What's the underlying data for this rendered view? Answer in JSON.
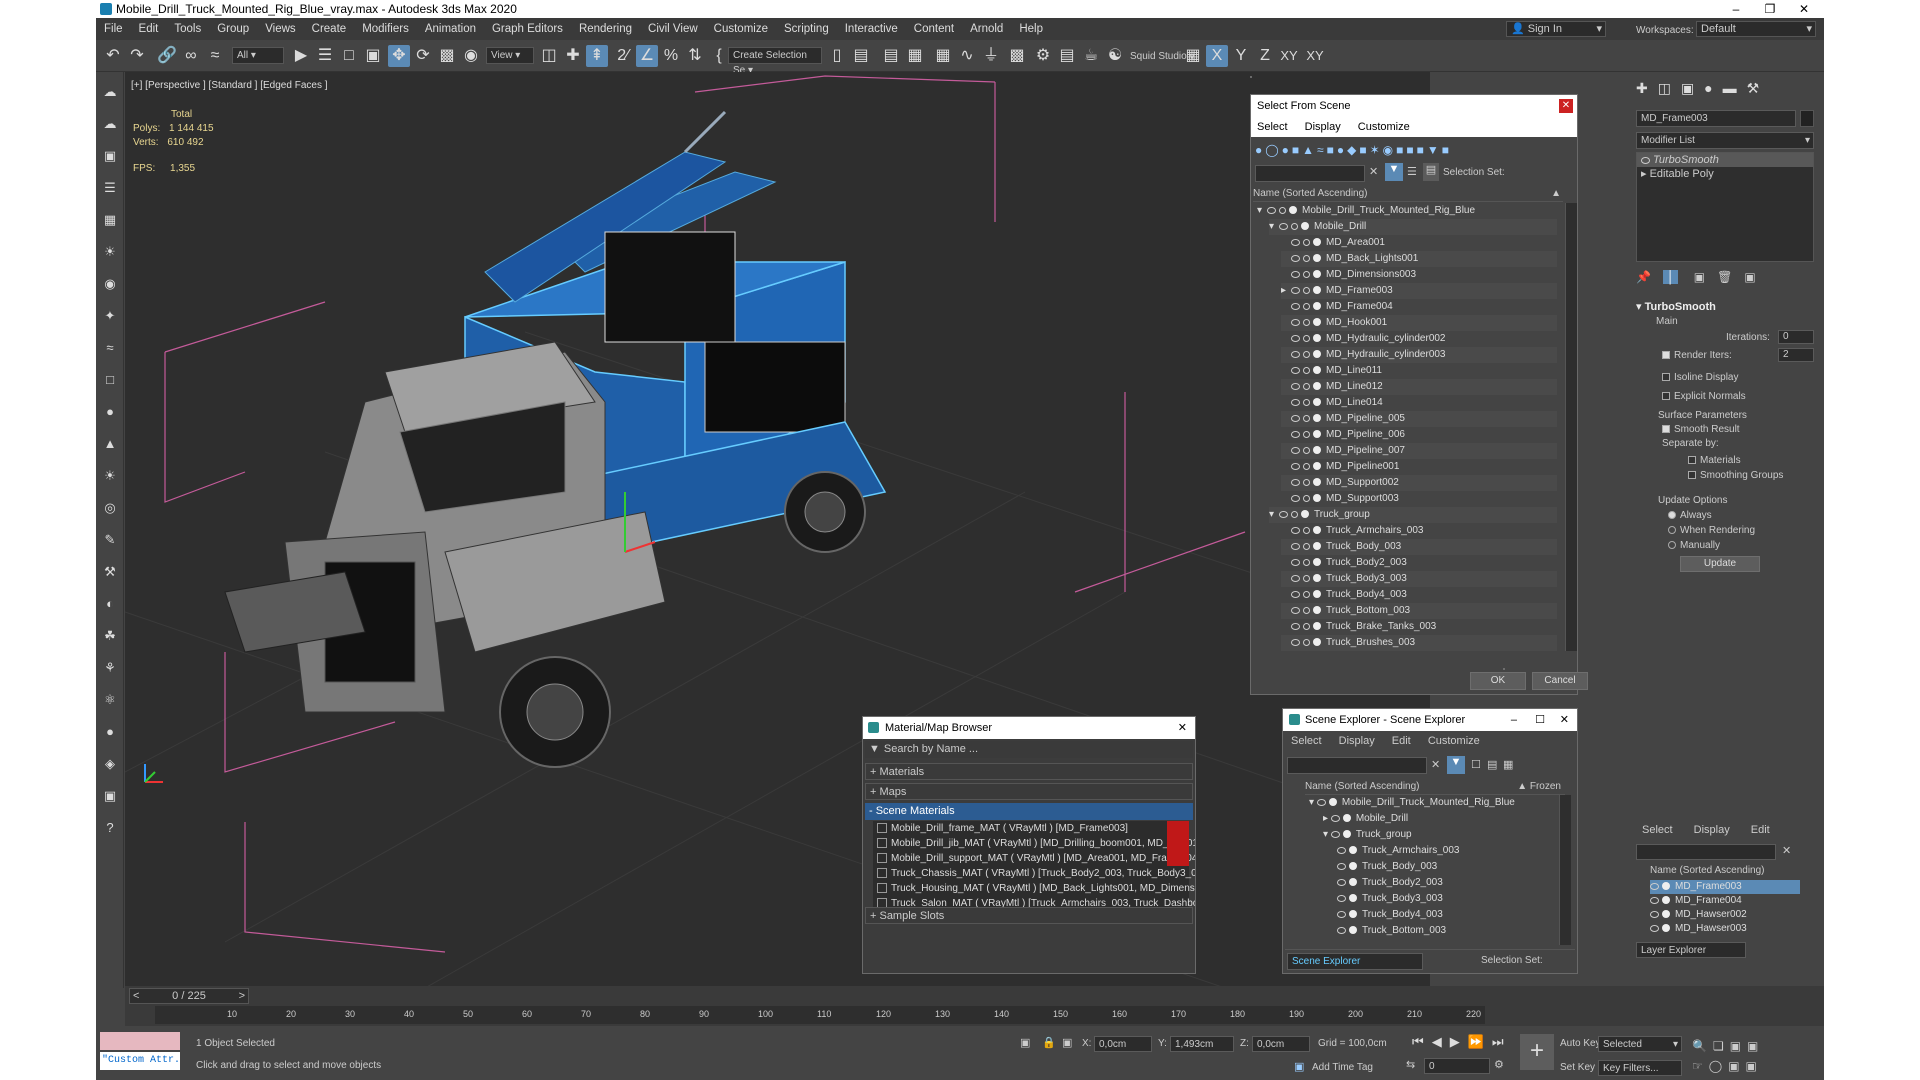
{
  "title": "Mobile_Drill_Truck_Mounted_Rig_Blue_vray.max - Autodesk 3ds Max 2020",
  "menu": [
    "File",
    "Edit",
    "Tools",
    "Group",
    "Views",
    "Create",
    "Modifiers",
    "Animation",
    "Graph Editors",
    "Rendering",
    "Civil View",
    "Customize",
    "Scripting",
    "Interactive",
    "Content",
    "Arnold",
    "Help"
  ],
  "signin": "Sign In",
  "workspaces_label": "Workspaces:",
  "workspace": "Default",
  "toolbar": {
    "filter": "All",
    "view": "View",
    "create_selection": "Create Selection Se",
    "squid": "Squid Studio v",
    "x": "X",
    "y": "Y",
    "z": "Z",
    "xy": "XY",
    "xy2": "XY"
  },
  "viewport": {
    "label": "[+] [Perspective ] [Standard ] [Edged Faces ]",
    "total": "Total",
    "polys_label": "Polys:",
    "polys": "1 144 415",
    "verts_label": "Verts:",
    "verts": "610 492",
    "fps_label": "FPS:",
    "fps": "1,355"
  },
  "select_scene": {
    "title": "Select From Scene",
    "menu": [
      "Select",
      "Display",
      "Customize"
    ],
    "selection_set": "Selection Set:",
    "col": "Name (Sorted Ascending)",
    "items": [
      {
        "n": "Mobile_Drill_Truck_Mounted_Rig_Blue",
        "l": 0,
        "g": true
      },
      {
        "n": "Mobile_Drill",
        "l": 1,
        "g": true
      },
      {
        "n": "MD_Area001",
        "l": 2
      },
      {
        "n": "MD_Back_Lights001",
        "l": 2
      },
      {
        "n": "MD_Dimensions003",
        "l": 2
      },
      {
        "n": "MD_Frame003",
        "l": 2
      },
      {
        "n": "MD_Frame004",
        "l": 2
      },
      {
        "n": "MD_Hook001",
        "l": 2
      },
      {
        "n": "MD_Hydraulic_cylinder002",
        "l": 2
      },
      {
        "n": "MD_Hydraulic_cylinder003",
        "l": 2
      },
      {
        "n": "MD_Line011",
        "l": 2
      },
      {
        "n": "MD_Line012",
        "l": 2
      },
      {
        "n": "MD_Line014",
        "l": 2
      },
      {
        "n": "MD_Pipeline_005",
        "l": 2
      },
      {
        "n": "MD_Pipeline_006",
        "l": 2
      },
      {
        "n": "MD_Pipeline_007",
        "l": 2
      },
      {
        "n": "MD_Pipeline001",
        "l": 2
      },
      {
        "n": "MD_Support002",
        "l": 2
      },
      {
        "n": "MD_Support003",
        "l": 2
      },
      {
        "n": "Truck_group",
        "l": 1,
        "g": true
      },
      {
        "n": "Truck_Armchairs_003",
        "l": 2
      },
      {
        "n": "Truck_Body_003",
        "l": 2
      },
      {
        "n": "Truck_Body2_003",
        "l": 2
      },
      {
        "n": "Truck_Body3_003",
        "l": 2
      },
      {
        "n": "Truck_Body4_003",
        "l": 2
      },
      {
        "n": "Truck_Bottom_003",
        "l": 2
      },
      {
        "n": "Truck_Brake_Tanks_003",
        "l": 2
      },
      {
        "n": "Truck_Brushes_003",
        "l": 2
      }
    ],
    "ok": "OK",
    "cancel": "Cancel"
  },
  "material_browser": {
    "title": "Material/Map Browser",
    "search": "Search by Name ...",
    "materials": "+ Materials",
    "maps": "+ Maps",
    "scene_materials": "- Scene Materials",
    "sample_slots": "+ Sample Slots",
    "mats": [
      "Mobile_Drill_frame_MAT  ( VRayMtl )  [MD_Frame003]",
      "Mobile_Drill_jib_MAT  ( VRayMtl )  [MD_Drilling_boom001, MD_Jib001]",
      "Mobile_Drill_support_MAT  ( VRayMtl )  [MD_Area001, MD_Frame004, MD_H...",
      "Truck_Chassis_MAT  ( VRayMtl )  [Truck_Body2_003, Truck_Body3_003, Tru...",
      "Truck_Housing_MAT  ( VRayMtl )  [MD_Back_Lights001, MD_Dimensions003]",
      "Truck_Salon_MAT  ( VRayMtl )  [Truck_Armchairs_003, Truck_Dashboard2_0..."
    ]
  },
  "scene_explorer": {
    "title": "Scene Explorer - Scene Explorer",
    "menu": [
      "Select",
      "Display",
      "Edit",
      "Customize"
    ],
    "col": "Name (Sorted Ascending)",
    "frozen": "▲ Frozen",
    "items": [
      {
        "n": "Mobile_Drill_Truck_Mounted_Rig_Blue",
        "l": 0
      },
      {
        "n": "Mobile_Drill",
        "l": 1
      },
      {
        "n": "Truck_group",
        "l": 1
      },
      {
        "n": "Truck_Armchairs_003",
        "l": 2
      },
      {
        "n": "Truck_Body_003",
        "l": 2
      },
      {
        "n": "Truck_Body2_003",
        "l": 2
      },
      {
        "n": "Truck_Body3_003",
        "l": 2
      },
      {
        "n": "Truck_Body4_003",
        "l": 2
      },
      {
        "n": "Truck_Bottom_003",
        "l": 2
      }
    ],
    "footer": "Scene Explorer",
    "selection_set": "Selection Set:"
  },
  "layer_panel": {
    "menu": [
      "Select",
      "Display",
      "Edit"
    ],
    "col": "Name (Sorted Ascending)",
    "items": [
      "MD_Frame003",
      "MD_Frame004",
      "MD_Hawser002",
      "MD_Hawser003"
    ],
    "footer": "Layer Explorer"
  },
  "command_panel": {
    "object": "MD_Frame003",
    "modlist": "Modifier List",
    "stack": [
      "TurboSmooth",
      "Editable Poly"
    ],
    "rollout": "TurboSmooth",
    "main": "Main",
    "iter_label": "Iterations:",
    "iter": "0",
    "render_iters_label": "Render Iters:",
    "render_iters": "2",
    "isoline": "Isoline Display",
    "explicit": "Explicit Normals",
    "surface": "Surface Parameters",
    "smooth_result": "Smooth Result",
    "separate": "Separate by:",
    "materials": "Materials",
    "smoothing": "Smoothing Groups",
    "update_opts": "Update Options",
    "always": "Always",
    "when_rendering": "When Rendering",
    "manually": "Manually",
    "update": "Update"
  },
  "timeline": {
    "frame": "0 / 225",
    "ticks": [
      "10",
      "20",
      "30",
      "40",
      "50",
      "60",
      "70",
      "80",
      "90",
      "100",
      "110",
      "120",
      "130",
      "140",
      "150",
      "160",
      "170",
      "180",
      "190",
      "200",
      "210",
      "220"
    ]
  },
  "status": {
    "maxscript": "\"Custom Attr.",
    "selected": "1 Object Selected",
    "prompt": "Click and drag to select and move objects",
    "x_label": "X:",
    "x": "0,0cm",
    "y_label": "Y:",
    "y": "1,493cm",
    "z_label": "Z:",
    "z": "0,0cm",
    "grid": "Grid = 100,0cm",
    "add_time_tag": "Add Time Tag",
    "auto_key": "Auto Key",
    "selected_dd": "Selected",
    "set_key": "Set Key",
    "key_filters": "Key Filters...",
    "frame_input": "0"
  }
}
